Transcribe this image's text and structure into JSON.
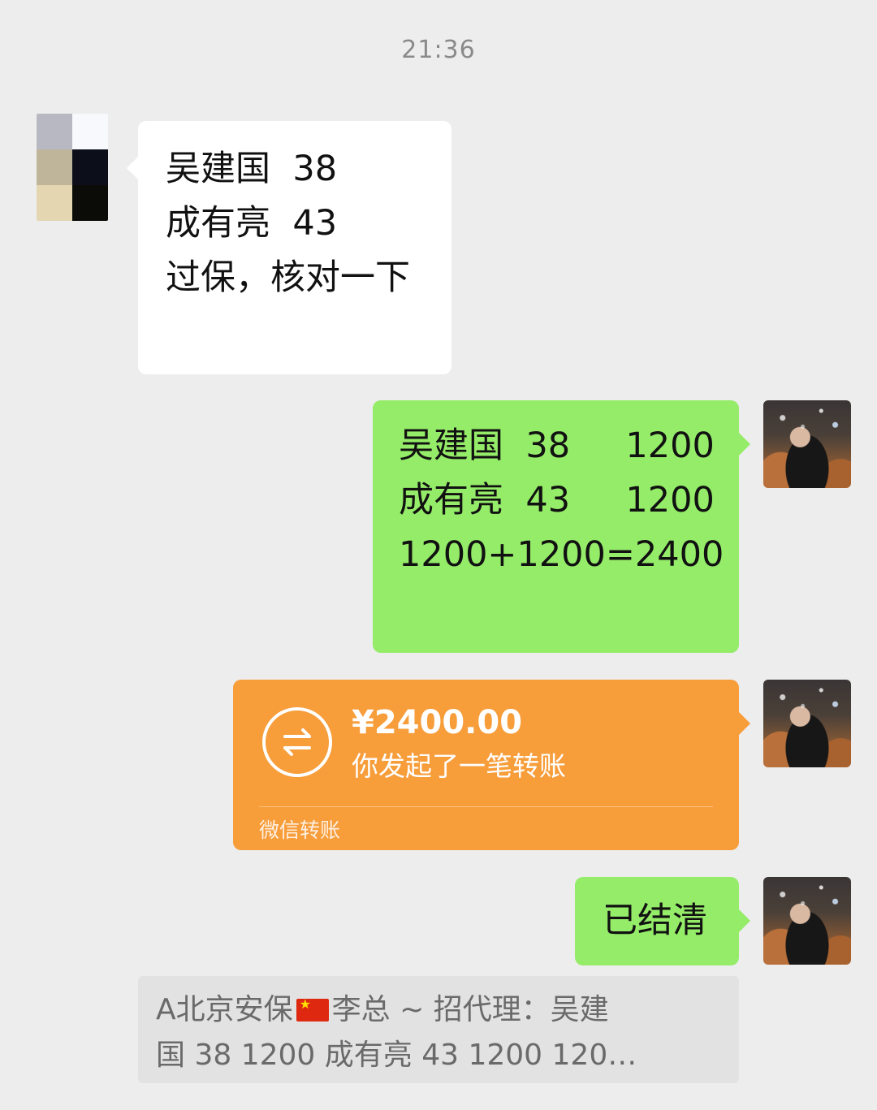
{
  "timestamp": "21:36",
  "messages": {
    "incoming_1": {
      "lines": [
        "吴建国  38",
        "成有亮  43",
        "",
        "过保，核对一下"
      ]
    },
    "outgoing_1": {
      "lines": [
        "吴建国  38     1200",
        "成有亮  43     1200",
        "",
        "1200+1200=2400"
      ]
    },
    "transfer": {
      "amount": "¥2400.00",
      "description": "你发起了一笔转账",
      "footer": "微信转账",
      "icon": "transfer-arrows-icon"
    },
    "outgoing_2": {
      "text": "已结清"
    }
  },
  "quote": {
    "sender_before_flag": "A北京安保",
    "flag_icon": "china-flag-icon",
    "sender_after_flag": "李总 ~ 招代理：吴建",
    "line2": "国  38     1200 成有亮  43     1200  120…"
  },
  "colors": {
    "background": "#ededed",
    "incoming_bubble": "#ffffff",
    "outgoing_bubble": "#95ec69",
    "transfer_card": "#f79d3a",
    "quote_background": "#e2e2e2"
  }
}
